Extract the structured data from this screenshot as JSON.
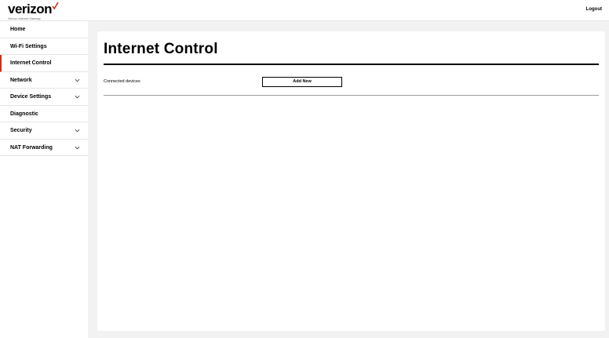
{
  "header": {
    "logo_text": "verizon",
    "logo_subtitle": "Verizon Internet Gateway",
    "logout_label": "Logout"
  },
  "sidebar": {
    "items": [
      {
        "label": "Home",
        "active": false,
        "has_submenu": false
      },
      {
        "label": "Wi-Fi Settings",
        "active": false,
        "has_submenu": false
      },
      {
        "label": "Internet Control",
        "active": true,
        "has_submenu": false
      },
      {
        "label": "Network",
        "active": false,
        "has_submenu": true
      },
      {
        "label": "Device Settings",
        "active": false,
        "has_submenu": true
      },
      {
        "label": "Diagnostic",
        "active": false,
        "has_submenu": false
      },
      {
        "label": "Security",
        "active": false,
        "has_submenu": true
      },
      {
        "label": "NAT Forwarding",
        "active": false,
        "has_submenu": true
      }
    ]
  },
  "main": {
    "title": "Internet Control",
    "connected_devices_label": "Connected devices",
    "add_new_label": "Add New"
  },
  "colors": {
    "accent": "#d52b1e",
    "background": "#f2f2f2",
    "panel": "#ffffff"
  }
}
